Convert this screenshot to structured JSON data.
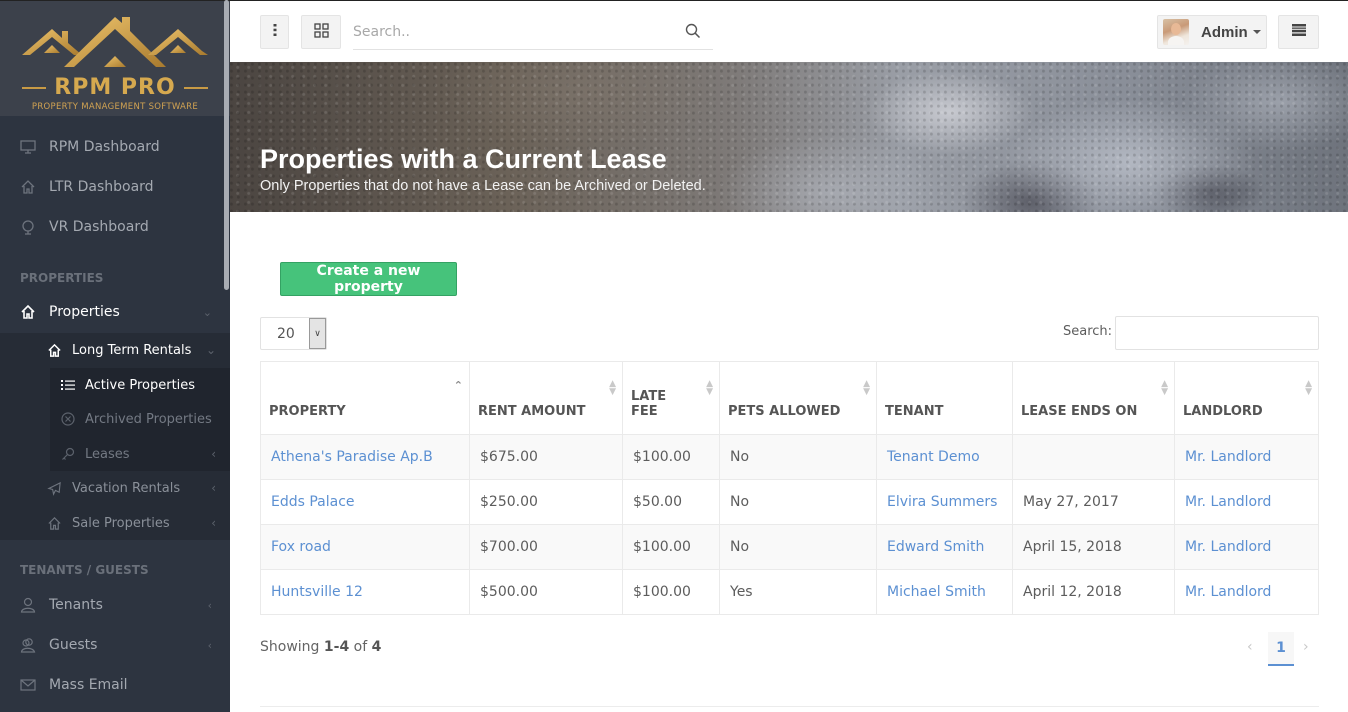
{
  "brand": {
    "name": "RPM PRO",
    "tagline": "PROPERTY MANAGEMENT SOFTWARE",
    "gold": "#d6a94f"
  },
  "sidebar": {
    "top_items": [
      {
        "label": "RPM Dashboard",
        "icon": "monitor-icon"
      },
      {
        "label": "LTR Dashboard",
        "icon": "home-icon"
      },
      {
        "label": "VR Dashboard",
        "icon": "globe-icon"
      }
    ],
    "section_properties": "PROPERTIES",
    "properties": {
      "label": "Properties",
      "icon": "home-icon"
    },
    "long_term_rentals": {
      "label": "Long Term Rentals",
      "icon": "home-icon"
    },
    "ltr_children": [
      {
        "label": "Active Properties",
        "icon": "list-icon",
        "active": true
      },
      {
        "label": "Archived Properties",
        "icon": "circle-x-icon"
      },
      {
        "label": "Leases",
        "icon": "key-icon"
      }
    ],
    "vacation_rentals": {
      "label": "Vacation Rentals",
      "icon": "plane-icon"
    },
    "sale_properties": {
      "label": "Sale Properties",
      "icon": "home-icon"
    },
    "section_tenants": "TENANTS / GUESTS",
    "tenant_items": [
      {
        "label": "Tenants",
        "icon": "user-icon"
      },
      {
        "label": "Guests",
        "icon": "users-icon"
      },
      {
        "label": "Mass Email",
        "icon": "envelope-icon"
      }
    ]
  },
  "topbar": {
    "search_placeholder": "Search..",
    "user_label": "Admin"
  },
  "hero": {
    "title": "Properties with a Current Lease",
    "subtitle": "Only Properties that do not have a Lease can be Archived or Deleted."
  },
  "content": {
    "create_button": "Create a new property",
    "page_length": "20",
    "search_label": "Search:",
    "search_value": ""
  },
  "table": {
    "columns": [
      {
        "line1": "",
        "line2": "Property",
        "sort": "asc"
      },
      {
        "line1": "",
        "line2": "Rent Amount",
        "sort": "both"
      },
      {
        "line1": "Late",
        "line2": "Fee",
        "sort": "both"
      },
      {
        "line1": "",
        "line2": "Pets Allowed",
        "sort": "both"
      },
      {
        "line1": "",
        "line2": "Tenant",
        "sort": "none"
      },
      {
        "line1": "",
        "line2": "Lease Ends On",
        "sort": "both"
      },
      {
        "line1": "",
        "line2": "Landlord",
        "sort": "both"
      }
    ],
    "rows": [
      {
        "property": "Athena's Paradise Ap.B",
        "rent": "$675.00",
        "late_fee": "$100.00",
        "pets": "No",
        "tenant": "Tenant Demo",
        "lease_ends": "",
        "landlord": "Mr. Landlord"
      },
      {
        "property": "Edds Palace",
        "rent": "$250.00",
        "late_fee": "$50.00",
        "pets": "No",
        "tenant": "Elvira Summers",
        "lease_ends": "May 27, 2017",
        "landlord": "Mr. Landlord"
      },
      {
        "property": "Fox road",
        "rent": "$700.00",
        "late_fee": "$100.00",
        "pets": "No",
        "tenant": "Edward Smith",
        "lease_ends": "April 15, 2018",
        "landlord": "Mr. Landlord"
      },
      {
        "property": "Huntsville 12",
        "rent": "$500.00",
        "late_fee": "$100.00",
        "pets": "Yes",
        "tenant": "Michael Smith",
        "lease_ends": "April 12, 2018",
        "landlord": "Mr. Landlord"
      }
    ]
  },
  "footer": {
    "showing_prefix": "Showing",
    "range": "1-4",
    "of": "of",
    "total": "4",
    "prev": "‹",
    "current_page": "1",
    "next": "›"
  },
  "colors": {
    "sidebar_bg": "#2d3440",
    "link": "#5c90d2",
    "success": "#46c37b"
  }
}
